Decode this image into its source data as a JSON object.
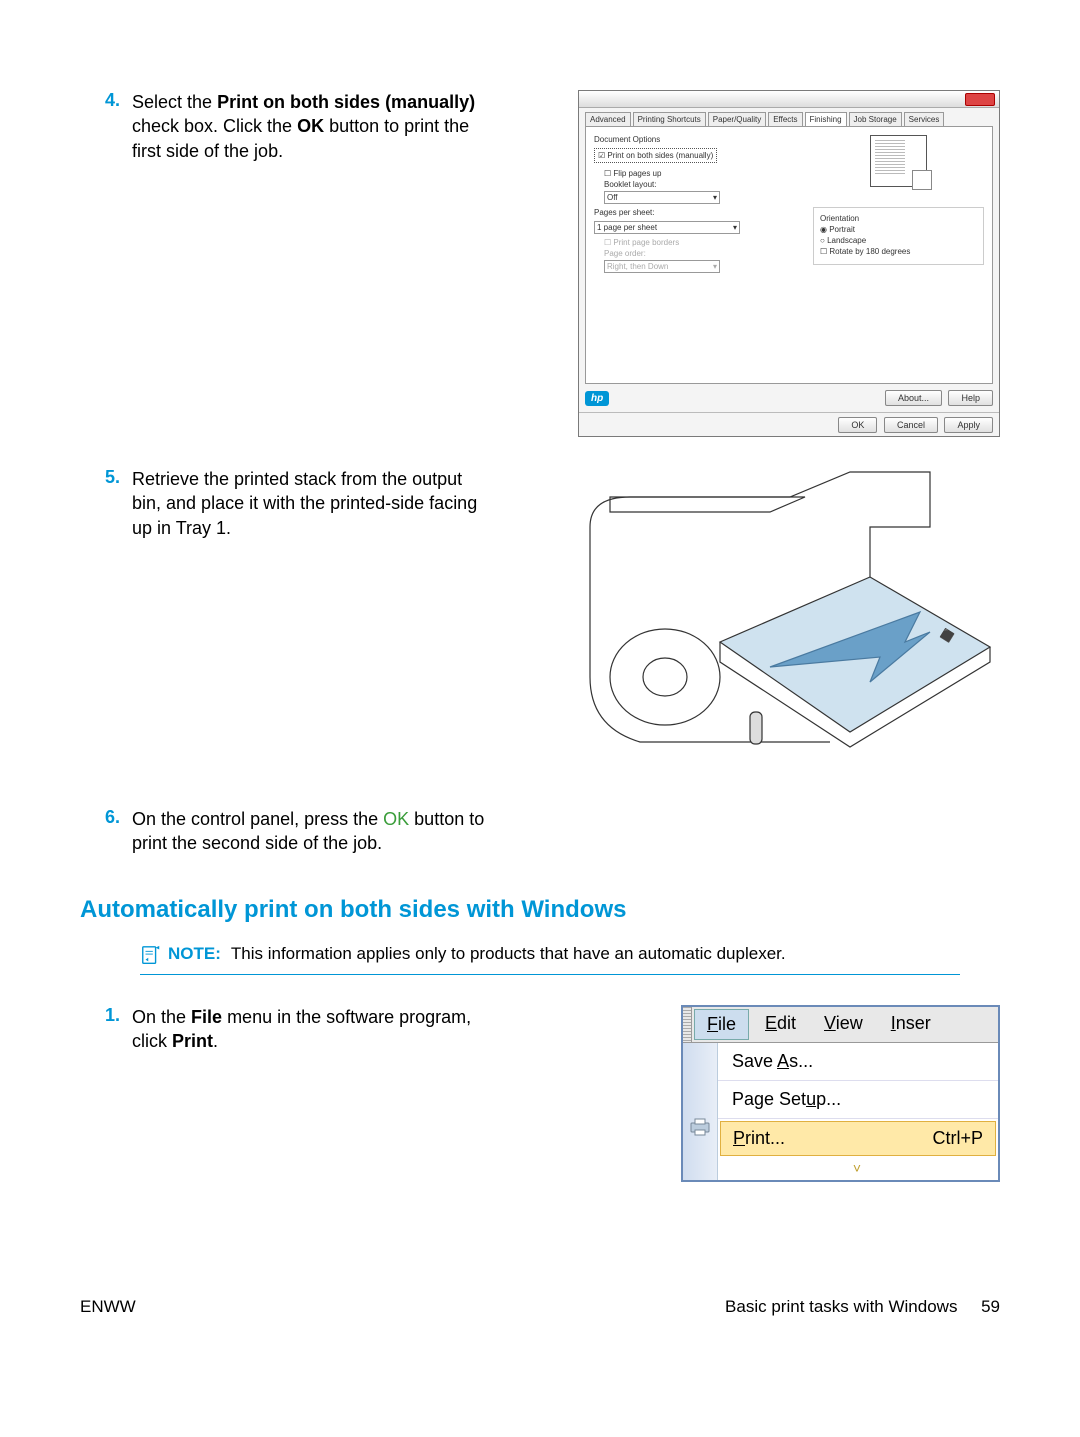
{
  "steps": {
    "s4": {
      "num": "4.",
      "pre": "Select the ",
      "bold1": "Print on both sides (manually)",
      "mid1": " check box. Click the ",
      "bold2": "OK",
      "post": " button to print the first side of the job."
    },
    "s5": {
      "num": "5.",
      "text": "Retrieve the printed stack from the output bin, and place it with the printed-side facing up in Tray 1."
    },
    "s6": {
      "num": "6.",
      "pre": "On the control panel, press the ",
      "ok": "OK",
      "post": " button to print the second side of the job."
    },
    "s1": {
      "num": "1.",
      "pre": "On the ",
      "bold1": "File",
      "mid": " menu in the software program, click ",
      "bold2": "Print",
      "post": "."
    }
  },
  "dialog": {
    "tabs": [
      "Advanced",
      "Printing Shortcuts",
      "Paper/Quality",
      "Effects",
      "Finishing",
      "Job Storage",
      "Services"
    ],
    "doc_options": "Document Options",
    "print_both": "Print on both sides (manually)",
    "flip_up": "Flip pages up",
    "booklet_layout": "Booklet layout:",
    "off": "Off",
    "pages_per_sheet": "Pages per sheet:",
    "one_pps": "1 page per sheet",
    "print_borders": "Print page borders",
    "page_order": "Page order:",
    "right_then_down": "Right, then Down",
    "orientation": "Orientation",
    "portrait": "Portrait",
    "landscape": "Landscape",
    "rotate": "Rotate by 180 degrees",
    "hp": "hp",
    "about": "About...",
    "help": "Help",
    "ok_btn": "OK",
    "cancel_btn": "Cancel",
    "apply_btn": "Apply"
  },
  "section_heading": "Automatically print on both sides with Windows",
  "note": {
    "label": "NOTE:",
    "text": "This information applies only to products that have an automatic duplexer."
  },
  "file_menu": {
    "menubar": {
      "file": "File",
      "edit": "Edit",
      "view": "View",
      "inser": "Inser"
    },
    "save_as": "Save As...",
    "page_setup": "Page Setup...",
    "print": "Print...",
    "shortcut": "Ctrl+P",
    "chevron": "˅"
  },
  "footer": {
    "left": "ENWW",
    "right_text": "Basic print tasks with Windows",
    "page_no": "59"
  }
}
